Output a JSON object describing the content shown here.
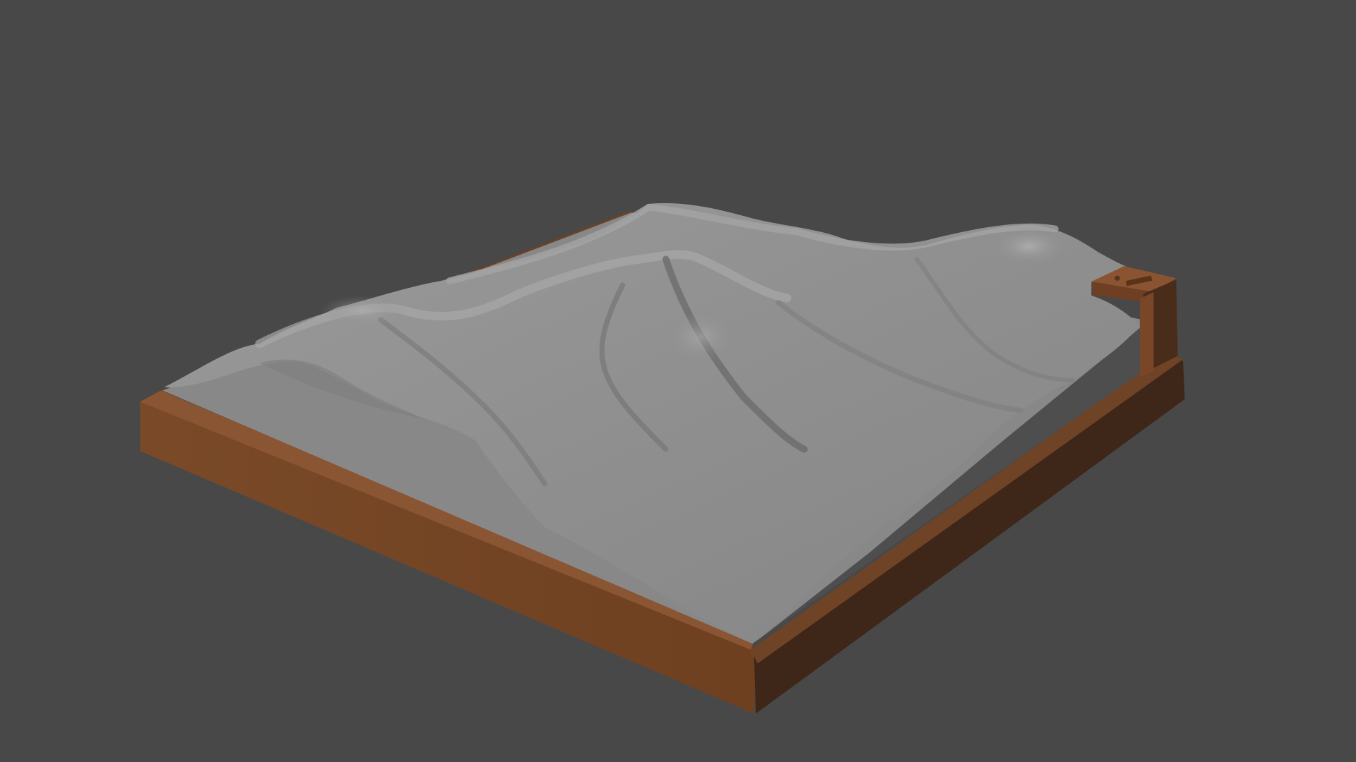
{
  "scene": {
    "subject": "terrain-model-on-base",
    "colors": {
      "background": "#484848",
      "terrain_light": "#a6a6a6",
      "terrain_mid": "#8e8e8e",
      "terrain_shadow": "#6f6f6f",
      "flat_surface": "#848484",
      "base_front": "#784828",
      "base_top": "#8a5530",
      "base_side": "#3c2418",
      "tab": "#7a4a2a"
    }
  }
}
